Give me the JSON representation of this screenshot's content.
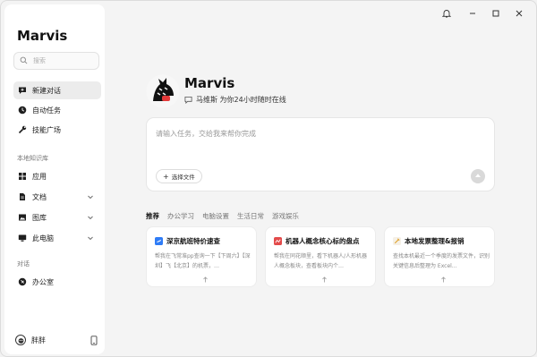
{
  "app": {
    "title": "Marvis"
  },
  "search": {
    "placeholder": "搜索"
  },
  "nav": {
    "primary": [
      {
        "label": "新建对话",
        "icon": "chat-plus-icon"
      },
      {
        "label": "自动任务",
        "icon": "clock-icon"
      },
      {
        "label": "技能广场",
        "icon": "wrench-icon"
      }
    ],
    "kb_label": "本地知识库",
    "kb": [
      {
        "label": "应用",
        "icon": "grid-icon"
      },
      {
        "label": "文档",
        "icon": "document-icon"
      },
      {
        "label": "图库",
        "icon": "image-icon"
      },
      {
        "label": "此电脑",
        "icon": "monitor-icon"
      }
    ],
    "conv_label": "对话",
    "conv": [
      {
        "label": "办公室",
        "icon": "pin-icon"
      }
    ]
  },
  "user": {
    "name": "胖胖"
  },
  "hero": {
    "name": "Marvis",
    "subtitle": "马维斯 为你24小时随时在线"
  },
  "task": {
    "placeholder": "请输入任务，交给我来帮你完成",
    "file_button": "选择文件"
  },
  "tabs": [
    "推荐",
    "办公学习",
    "电脑设置",
    "生活日常",
    "游戏娱乐"
  ],
  "cards": [
    {
      "title": "深京航班特价速查",
      "desc": "帮我在飞常准pp查询一下【下周六】【深圳】飞【北京】的机票，…",
      "icon_color": "#2f7cf6"
    },
    {
      "title": "机器人概念核心标的盘点",
      "desc": "帮我在同花顺里，看下机器人/人形机器人概念板块，查看板块内个…",
      "icon_color": "#e34b4b"
    },
    {
      "title": "本地发票整理&报销",
      "desc": "查找本机最近一个季度的发票文件，识别关键信息后整理为 Excel…",
      "icon_color": "#e0a12b"
    }
  ]
}
